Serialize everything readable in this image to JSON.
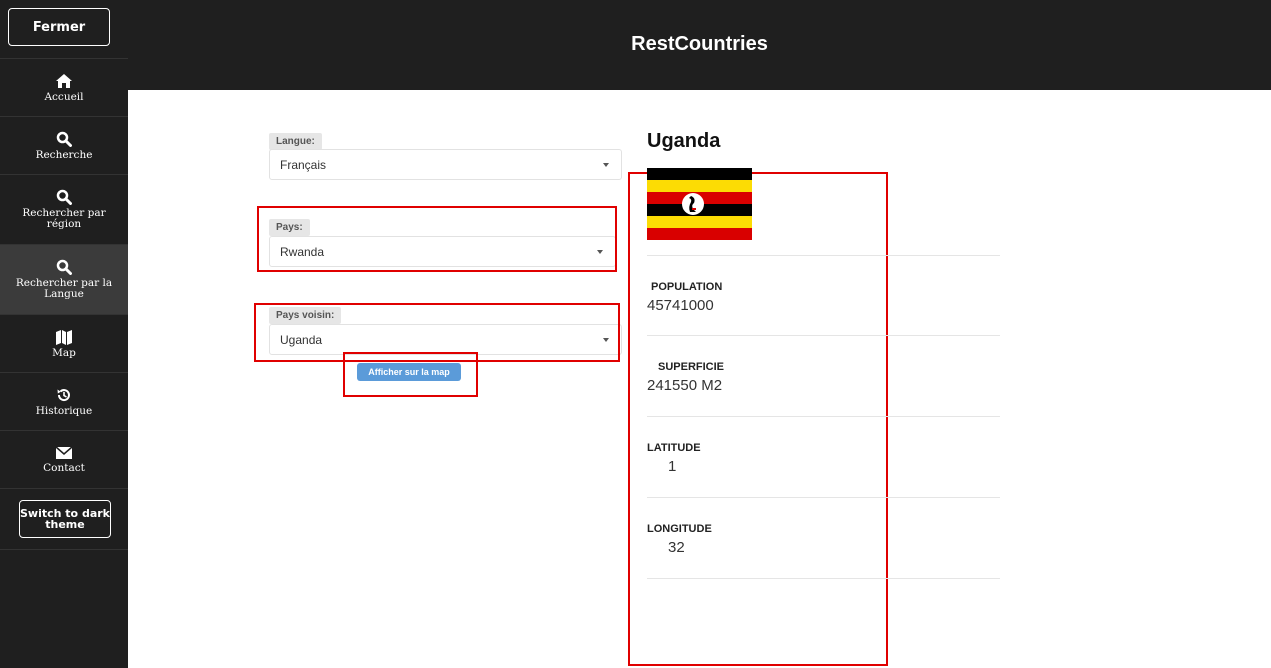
{
  "sidebar": {
    "close_label": "Fermer",
    "items": [
      {
        "label": "Accueil",
        "icon": "home-icon"
      },
      {
        "label": "Recherche",
        "icon": "search-icon"
      },
      {
        "label": "Rechercher par région",
        "icon": "search-icon"
      },
      {
        "label": "Rechercher par la Langue",
        "icon": "search-icon",
        "active": true
      },
      {
        "label": "Map",
        "icon": "map-icon"
      },
      {
        "label": "Historique",
        "icon": "history-icon"
      },
      {
        "label": "Contact",
        "icon": "envelope-icon"
      }
    ],
    "theme_label": "Switch to dark theme"
  },
  "header": {
    "title": "RestCountries"
  },
  "form": {
    "language": {
      "label": "Langue:",
      "value": "Français"
    },
    "country": {
      "label": "Pays:",
      "value": "Rwanda"
    },
    "neighbor": {
      "label": "Pays voisin:",
      "value": "Uganda"
    },
    "map_button": "Afficher sur la map"
  },
  "country": {
    "name": "Uganda",
    "population_label": "POPULATION",
    "population_value": "45741000",
    "area_label": "SUPERFICIE",
    "area_value": "241550 M2",
    "latitude_label": "LATITUDE",
    "latitude_value": "1",
    "longitude_label": "LONGITUDE",
    "longitude_value": "32"
  },
  "colors": {
    "sidebar_bg": "#1f1f1f",
    "accent_button": "#5b9bd9",
    "highlight_box": "#e00000"
  }
}
